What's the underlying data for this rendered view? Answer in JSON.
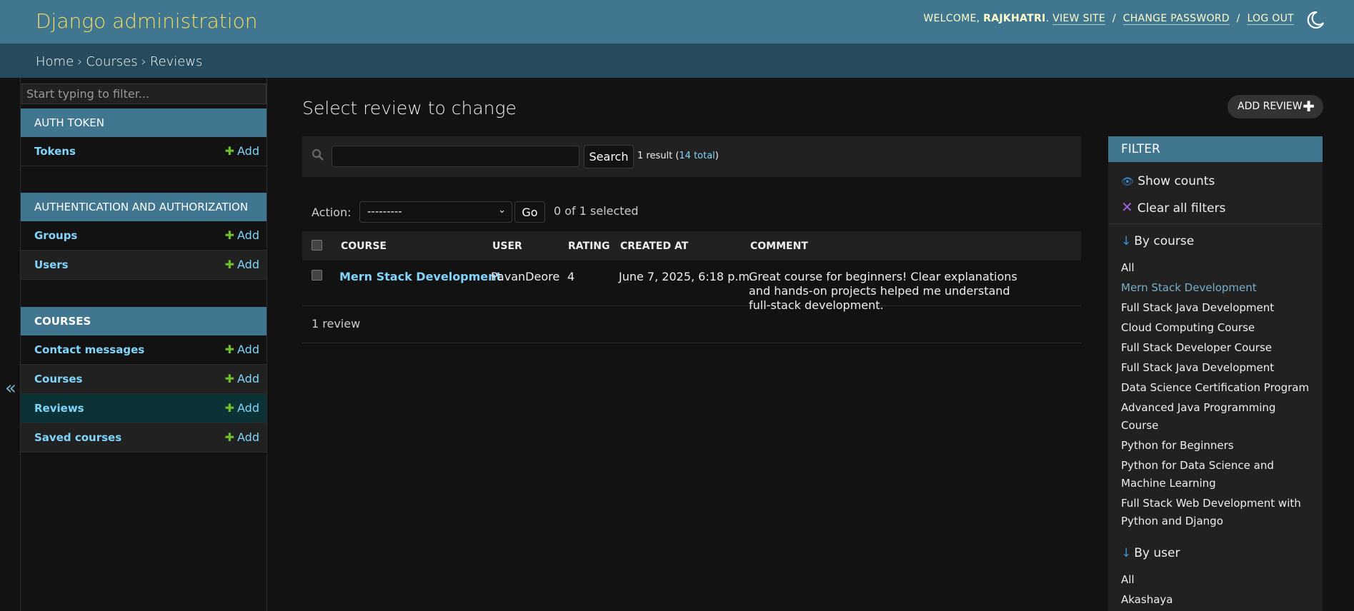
{
  "header": {
    "branding": "Django administration",
    "welcome": "WELCOME, ",
    "username": "RAJKHATRI",
    "welcome_end": ".",
    "view_site": "VIEW SITE",
    "change_password": "CHANGE PASSWORD",
    "log_out": "LOG OUT",
    "separator": "/"
  },
  "breadcrumbs": {
    "items": [
      "Home",
      "Courses",
      "Reviews"
    ],
    "separator": "›"
  },
  "sidebar": {
    "filter_placeholder": "Start typing to filter...",
    "collapse_glyph": "«",
    "add_label": "Add",
    "modules": [
      {
        "caption": "AUTH TOKEN",
        "models": [
          "Tokens"
        ]
      },
      {
        "caption": "AUTHENTICATION AND AUTHORIZATION",
        "models": [
          "Groups",
          "Users"
        ]
      },
      {
        "caption": "COURSES",
        "models": [
          "Contact messages",
          "Courses",
          "Reviews",
          "Saved courses"
        ]
      }
    ]
  },
  "main": {
    "title": "Select review to change",
    "add_button": "ADD REVIEW",
    "search_button": "Search",
    "result_count": "1 result (",
    "result_total": "14 total",
    "result_close": ")",
    "action_label": "Action:",
    "action_selected": "---------",
    "go_button": "Go",
    "selected_count": "0 of 1 selected",
    "columns": [
      "COURSE",
      "USER",
      "RATING",
      "CREATED AT",
      "COMMENT"
    ],
    "rows": [
      {
        "course": "Mern Stack Development",
        "user": "PavanDeore",
        "rating": "4",
        "created_at": "June 7, 2025, 6:18 p.m.",
        "comment": "Great course for beginners! Clear explanations and hands-on projects helped me understand full-stack development."
      }
    ],
    "paginator": "1 review"
  },
  "filter": {
    "title": "FILTER",
    "show_counts": "Show counts",
    "clear_all": "Clear all filters",
    "by_course_heading": "By course",
    "by_course_options": [
      "All",
      "Mern Stack Development",
      "Full Stack Java Development",
      "Cloud Computing Course",
      "Full Stack Developer Course",
      "Full Stack Java Development",
      "Data Science Certification Program",
      "Advanced Java Programming Course",
      "Python for Beginners",
      "Python for Data Science and Machine Learning",
      "Full Stack Web Development with Python and Django"
    ],
    "by_course_selected": "Mern Stack Development",
    "by_user_heading": "By user",
    "by_user_options": [
      "All",
      "Akashaya"
    ]
  },
  "colors": {
    "header_bg": "#417690",
    "breadcrumb_bg": "#264b5d",
    "branding": "#f5dd5d",
    "link": "#81d4fa",
    "add_plus": "#70bf2b"
  }
}
